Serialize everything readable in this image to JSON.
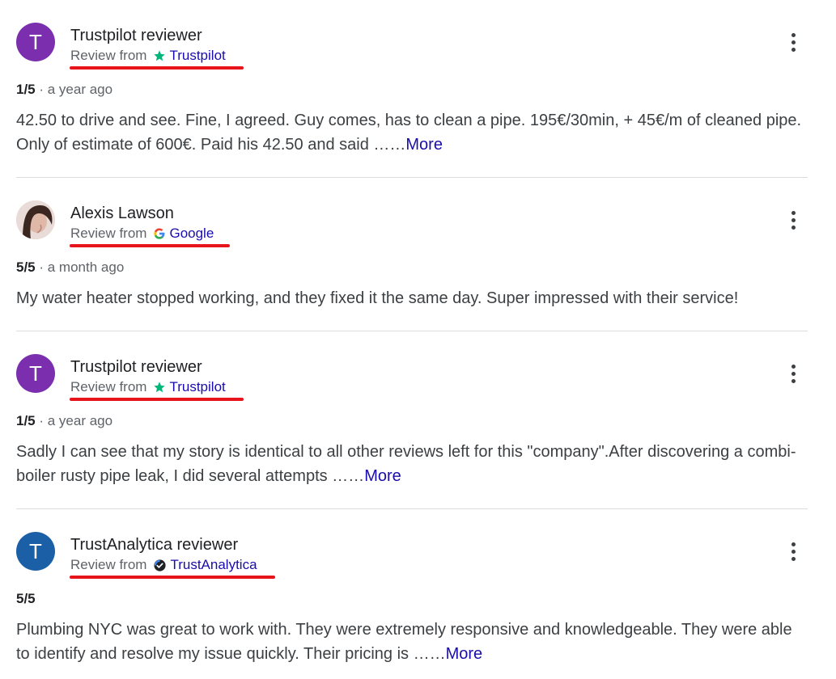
{
  "reviews": [
    {
      "avatar_letter": "T",
      "avatar_color": "#7b2fae",
      "name": "Trustpilot reviewer",
      "review_from": "Review from",
      "source": "Trustpilot",
      "source_icon": "star-icon",
      "rating": "1/5",
      "time": "· a year ago",
      "text": "42.50 to drive and see. Fine, I agreed. Guy comes, has to clean a pipe. 195€/30min, + 45€/m of cleaned pipe. Only of estimate of 600€. Paid his 42.50 and said ……",
      "more": "More"
    },
    {
      "avatar_letter": "",
      "avatar_color": "#d9c5c0",
      "name": "Alexis Lawson",
      "review_from": "Review from",
      "source": "Google",
      "source_icon": "google-g-icon",
      "rating": "5/5",
      "time": "· a month ago",
      "text": "My water heater stopped working, and they fixed it the same day. Super impressed with their service!",
      "more": ""
    },
    {
      "avatar_letter": "T",
      "avatar_color": "#7b2fae",
      "name": "Trustpilot reviewer",
      "review_from": "Review from",
      "source": "Trustpilot",
      "source_icon": "star-icon",
      "rating": "1/5",
      "time": "· a year ago",
      "text": "Sadly I can see that my story is identical to all other reviews left for this \"company\".After discovering a combi-boiler rusty pipe leak, I did several attempts ……",
      "more": "More"
    },
    {
      "avatar_letter": "T",
      "avatar_color": "#1b5fa6",
      "name": "TrustAnalytica reviewer",
      "review_from": "Review from",
      "source": "TrustAnalytica",
      "source_icon": "verified-check-icon",
      "rating": "5/5",
      "time": "",
      "text": "Plumbing NYC was great to work with. They were extremely responsive and knowledgeable. They were able to identify and resolve my issue quickly. Their pricing is ……",
      "more": "More"
    }
  ],
  "colors": {
    "link": "#1a0dab",
    "underline_highlight": "#e8141b",
    "trustpilot_star": "#00b67a"
  }
}
